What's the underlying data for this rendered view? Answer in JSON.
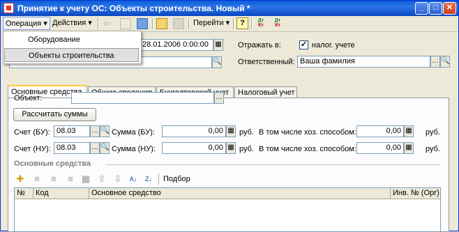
{
  "window": {
    "title": "Принятие к учету ОС: Объекты строительства. Новый *",
    "min": "_",
    "max": "□",
    "close": "✕"
  },
  "toolbar": {
    "operation": "Операция",
    "actions": "Действия",
    "goto": "Перейти",
    "help": "?",
    "dt_kt": "Дт\nКт"
  },
  "menu": {
    "items": [
      "Оборудование",
      "Объекты строительства"
    ]
  },
  "header": {
    "date_value": "28.01.2006  0:00:00",
    "reflect_label": "Отражать в:",
    "tax_label": "налог. учете",
    "responsible_label": "Ответственный:",
    "responsible_value": "Ваша фамилия"
  },
  "tabs": [
    "Основные средства",
    "Общие сведения",
    "Бухгалтерский учет",
    "Налоговый учет"
  ],
  "main": {
    "object_label": "Объект:",
    "object_value": "",
    "calc_button": "Рассчитать суммы",
    "acc_bu_label": "Счет (БУ):",
    "acc_bu_value": "08.03",
    "sum_bu_label": "Сумма (БУ):",
    "sum_bu_value": "0,00",
    "rub1": "руб.",
    "incl_label1": "В том числе хоз. способом:",
    "incl_value1": "0,00",
    "rub2": "руб.",
    "acc_nu_label": "Счет (НУ):",
    "acc_nu_value": "08.03",
    "sum_nu_label": "Сумма (НУ):",
    "sum_nu_value": "0,00",
    "rub3": "руб.",
    "incl_label2": "В том числе хоз. способом:",
    "incl_value2": "0,00",
    "rub4": "руб."
  },
  "section": {
    "title": "Основные средства",
    "pick": "Подбор"
  },
  "grid": {
    "columns": [
      "№",
      "Код",
      "Основное средство",
      "Инв. № (Орг)"
    ]
  },
  "colors": {
    "title_bar": "#0a5fd8",
    "menu_highlight": "#e0e0e0"
  }
}
